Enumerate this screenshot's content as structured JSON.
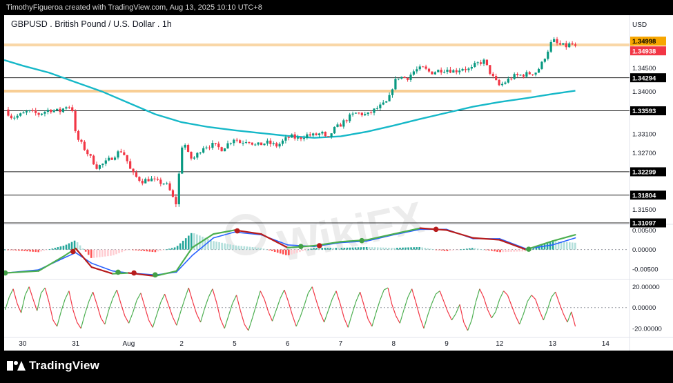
{
  "header": {
    "caption": "TimothyFigueroa created with TradingView.com, Aug 13, 2025 10:10 UTC+8"
  },
  "footer": {
    "brand": "TradingView"
  },
  "watermark": {
    "text": "WikiFX"
  },
  "chart_data": {
    "type": "candlestick",
    "title": "GBPUSD . British Pound / U.S. Dollar . 1h",
    "currency": "USD",
    "price_axis": {
      "range": [
        1.312,
        1.3527
      ],
      "ticks": [
        {
          "value": 1.345,
          "label": "1.34500"
        },
        {
          "value": 1.34,
          "label": "1.34000"
        },
        {
          "value": 1.331,
          "label": "1.33100"
        },
        {
          "value": 1.327,
          "label": "1.32700"
        },
        {
          "value": 1.315,
          "label": "1.31500"
        }
      ],
      "price_labels": [
        {
          "value": 1.34998,
          "label": "1.34998",
          "bg": "#f7a600",
          "fg": "#000000"
        },
        {
          "value": 1.34938,
          "label": "1.34938",
          "bg": "#f23645",
          "fg": "#ffffff"
        },
        {
          "value": 1.34294,
          "label": "1.34294",
          "bg": "#000000",
          "fg": "#ffffff"
        },
        {
          "value": 1.33593,
          "label": "1.33593",
          "bg": "#000000",
          "fg": "#ffffff"
        },
        {
          "value": 1.32299,
          "label": "1.32299",
          "bg": "#000000",
          "fg": "#ffffff"
        },
        {
          "value": 1.31804,
          "label": "1.31804",
          "bg": "#000000",
          "fg": "#ffffff"
        },
        {
          "value": 1.31097,
          "label": "1.31097",
          "bg": "#000000",
          "fg": "#ffffff"
        }
      ]
    },
    "horizontal_lines": [
      1.34294,
      1.33593,
      1.32299,
      1.31804,
      1.31097
    ],
    "resistance_band": [
      1.3496,
      1.3502
    ],
    "support_band": [
      1.3398,
      1.3404
    ],
    "time_axis": {
      "labels": [
        {
          "t": 0.0,
          "label": "30"
        },
        {
          "t": 1.0,
          "label": "31"
        },
        {
          "t": 2.0,
          "label": "Aug"
        },
        {
          "t": 3.0,
          "label": "2"
        },
        {
          "t": 4.0,
          "label": "5"
        },
        {
          "t": 5.0,
          "label": "6"
        },
        {
          "t": 6.0,
          "label": "7"
        },
        {
          "t": 7.0,
          "label": "8"
        },
        {
          "t": 8.0,
          "label": "9"
        },
        {
          "t": 9.0,
          "label": "12"
        },
        {
          "t": 10.0,
          "label": "13"
        },
        {
          "t": 11.0,
          "label": "14"
        }
      ],
      "range": [
        -0.35,
        11.4
      ]
    },
    "price_path": [
      [
        -0.33,
        1.3362
      ],
      [
        -0.2,
        1.3345
      ],
      [
        -0.05,
        1.335
      ],
      [
        0.1,
        1.3358
      ],
      [
        0.3,
        1.3352
      ],
      [
        0.5,
        1.3362
      ],
      [
        0.7,
        1.3358
      ],
      [
        0.85,
        1.3372
      ],
      [
        0.95,
        1.336
      ],
      [
        1.0,
        1.3305
      ],
      [
        1.1,
        1.329
      ],
      [
        1.25,
        1.3265
      ],
      [
        1.4,
        1.324
      ],
      [
        1.55,
        1.3248
      ],
      [
        1.7,
        1.3262
      ],
      [
        1.85,
        1.3275
      ],
      [
        1.95,
        1.3262
      ],
      [
        2.0,
        1.324
      ],
      [
        2.1,
        1.3222
      ],
      [
        2.25,
        1.321
      ],
      [
        2.4,
        1.3215
      ],
      [
        2.55,
        1.3208
      ],
      [
        2.7,
        1.3205
      ],
      [
        2.8,
        1.3185
      ],
      [
        2.88,
        1.316
      ],
      [
        2.92,
        1.317
      ],
      [
        2.98,
        1.328
      ],
      [
        3.05,
        1.3292
      ],
      [
        3.15,
        1.3258
      ],
      [
        3.25,
        1.326
      ],
      [
        3.4,
        1.3283
      ],
      [
        3.6,
        1.3287
      ],
      [
        3.75,
        1.3278
      ],
      [
        3.9,
        1.3292
      ],
      [
        4.0,
        1.3302
      ],
      [
        4.1,
        1.3292
      ],
      [
        4.25,
        1.3298
      ],
      [
        4.4,
        1.3285
      ],
      [
        4.6,
        1.3292
      ],
      [
        4.8,
        1.3285
      ],
      [
        4.95,
        1.3298
      ],
      [
        5.05,
        1.3305
      ],
      [
        5.2,
        1.33
      ],
      [
        5.35,
        1.3308
      ],
      [
        5.5,
        1.3307
      ],
      [
        5.65,
        1.3312
      ],
      [
        5.75,
        1.3295
      ],
      [
        5.85,
        1.3318
      ],
      [
        6.0,
        1.333
      ],
      [
        6.15,
        1.3345
      ],
      [
        6.3,
        1.3355
      ],
      [
        6.5,
        1.335
      ],
      [
        6.65,
        1.3362
      ],
      [
        6.8,
        1.3372
      ],
      [
        6.9,
        1.338
      ],
      [
        7.0,
        1.3418
      ],
      [
        7.1,
        1.3432
      ],
      [
        7.25,
        1.3428
      ],
      [
        7.4,
        1.3445
      ],
      [
        7.55,
        1.345
      ],
      [
        7.7,
        1.344
      ],
      [
        7.85,
        1.3445
      ],
      [
        8.0,
        1.3448
      ],
      [
        8.15,
        1.3443
      ],
      [
        8.3,
        1.345
      ],
      [
        8.45,
        1.3446
      ],
      [
        8.55,
        1.3458
      ],
      [
        8.7,
        1.3465
      ],
      [
        8.8,
        1.3445
      ],
      [
        8.9,
        1.3425
      ],
      [
        9.0,
        1.3412
      ],
      [
        9.1,
        1.342
      ],
      [
        9.25,
        1.3432
      ],
      [
        9.4,
        1.3435
      ],
      [
        9.55,
        1.3438
      ],
      [
        9.7,
        1.3442
      ],
      [
        9.8,
        1.346
      ],
      [
        9.9,
        1.3485
      ],
      [
        10.0,
        1.351
      ],
      [
        10.1,
        1.35
      ],
      [
        10.25,
        1.3496
      ],
      [
        10.35,
        1.3502
      ],
      [
        10.43,
        1.3494
      ]
    ],
    "moving_average": [
      [
        -0.35,
        1.3467
      ],
      [
        0.0,
        1.3455
      ],
      [
        0.5,
        1.344
      ],
      [
        1.0,
        1.342
      ],
      [
        1.5,
        1.34
      ],
      [
        2.0,
        1.3376
      ],
      [
        2.5,
        1.3352
      ],
      [
        3.0,
        1.3335
      ],
      [
        3.5,
        1.3325
      ],
      [
        4.0,
        1.3318
      ],
      [
        4.5,
        1.3312
      ],
      [
        5.0,
        1.3306
      ],
      [
        5.5,
        1.3302
      ],
      [
        6.0,
        1.3305
      ],
      [
        6.5,
        1.3315
      ],
      [
        7.0,
        1.3328
      ],
      [
        7.5,
        1.3342
      ],
      [
        8.0,
        1.3355
      ],
      [
        8.5,
        1.3368
      ],
      [
        9.0,
        1.3378
      ],
      [
        9.5,
        1.3386
      ],
      [
        10.0,
        1.3395
      ],
      [
        10.43,
        1.3402
      ]
    ],
    "macd": {
      "axis": [
        {
          "value": 0.005,
          "label": "0.00500"
        },
        {
          "value": 0.0,
          "label": "0.00000"
        },
        {
          "value": -0.005,
          "label": "-0.00500"
        }
      ],
      "range": [
        -0.0075,
        0.0065
      ],
      "macd_line": [
        [
          -0.33,
          -0.006
        ],
        [
          0.3,
          -0.0055
        ],
        [
          0.8,
          -0.0015
        ],
        [
          1.0,
          0.0003
        ],
        [
          1.3,
          -0.0045
        ],
        [
          1.7,
          -0.0062
        ],
        [
          2.0,
          -0.006
        ],
        [
          2.5,
          -0.0068
        ],
        [
          2.9,
          -0.0055
        ],
        [
          3.2,
          0.0005
        ],
        [
          3.6,
          0.004
        ],
        [
          4.0,
          0.005
        ],
        [
          4.5,
          0.004
        ],
        [
          5.0,
          0.0005
        ],
        [
          5.5,
          0.001
        ],
        [
          6.0,
          0.002
        ],
        [
          6.5,
          0.0025
        ],
        [
          7.0,
          0.004
        ],
        [
          7.5,
          0.0055
        ],
        [
          8.0,
          0.005
        ],
        [
          8.5,
          0.003
        ],
        [
          9.0,
          0.0025
        ],
        [
          9.5,
          0.0
        ],
        [
          10.0,
          0.0022
        ],
        [
          10.43,
          0.0038
        ]
      ],
      "signal_line": [
        [
          -0.33,
          -0.006
        ],
        [
          0.3,
          -0.0052
        ],
        [
          0.8,
          -0.002
        ],
        [
          1.0,
          -0.0008
        ],
        [
          1.3,
          -0.0035
        ],
        [
          1.7,
          -0.0055
        ],
        [
          2.0,
          -0.006
        ],
        [
          2.5,
          -0.0065
        ],
        [
          2.9,
          -0.0058
        ],
        [
          3.2,
          -0.0015
        ],
        [
          3.6,
          0.003
        ],
        [
          4.0,
          0.0045
        ],
        [
          4.5,
          0.0038
        ],
        [
          5.0,
          0.0012
        ],
        [
          5.5,
          0.0008
        ],
        [
          6.0,
          0.0018
        ],
        [
          6.5,
          0.0022
        ],
        [
          7.0,
          0.0038
        ],
        [
          7.5,
          0.0052
        ],
        [
          8.0,
          0.0052
        ],
        [
          8.5,
          0.0028
        ],
        [
          9.0,
          0.0028
        ],
        [
          9.5,
          0.0002
        ],
        [
          10.0,
          0.0012
        ],
        [
          10.43,
          0.003
        ]
      ],
      "crosses": [
        {
          "t": -0.33,
          "v": -0.006,
          "kind": "bull"
        },
        {
          "t": 0.95,
          "v": -0.0005,
          "kind": "bear"
        },
        {
          "t": 1.8,
          "v": -0.0058,
          "kind": "bull"
        },
        {
          "t": 2.1,
          "v": -0.006,
          "kind": "bear"
        },
        {
          "t": 2.5,
          "v": -0.0065,
          "kind": "bull"
        },
        {
          "t": 4.05,
          "v": 0.0048,
          "kind": "bear"
        },
        {
          "t": 5.25,
          "v": 0.0008,
          "kind": "bull"
        },
        {
          "t": 5.6,
          "v": 0.001,
          "kind": "bear"
        },
        {
          "t": 6.4,
          "v": 0.0023,
          "kind": "bull"
        },
        {
          "t": 7.8,
          "v": 0.0052,
          "kind": "bear"
        },
        {
          "t": 9.55,
          "v": 0.0001,
          "kind": "bull"
        }
      ]
    },
    "oscillator": {
      "axis": [
        {
          "value": 20,
          "label": "20.00000"
        },
        {
          "value": 0,
          "label": "0.00000"
        },
        {
          "value": -20,
          "label": "-20.00000"
        }
      ],
      "range": [
        -28,
        27
      ],
      "values": [
        -2,
        10,
        18,
        4,
        -5,
        12,
        20,
        8,
        -3,
        14,
        19,
        5,
        -12,
        -18,
        -4,
        8,
        16,
        -2,
        -14,
        -20,
        -6,
        6,
        15,
        3,
        -10,
        -16,
        -2,
        9,
        17,
        4,
        -8,
        -15,
        -5,
        7,
        14,
        1,
        -12,
        -19,
        -7,
        5,
        13,
        2,
        -9,
        -17,
        -4,
        8,
        19,
        6,
        -6,
        -14,
        -1,
        10,
        18,
        5,
        -11,
        -20,
        -8,
        4,
        12,
        -3,
        -16,
        -22,
        -10,
        3,
        16,
        8,
        -4,
        -13,
        -2,
        9,
        17,
        6,
        -7,
        -18,
        -9,
        2,
        14,
        20,
        7,
        -5,
        -14,
        -3,
        8,
        16,
        4,
        -10,
        -19,
        -6,
        6,
        15,
        2,
        -11,
        -18,
        -5,
        7,
        17,
        19,
        3,
        -8,
        -15,
        -2,
        10,
        18,
        5,
        -9,
        -20,
        -7,
        4,
        13,
        16,
        6,
        -4,
        -12,
        -6,
        3,
        -14,
        -22,
        -12,
        5,
        18,
        10,
        -2,
        -10,
        -4,
        8,
        16,
        12,
        2,
        -8,
        -16,
        -6,
        6,
        12,
        8,
        -3,
        -12,
        -2,
        10,
        15,
        4,
        -6,
        -14,
        -4,
        -18
      ]
    }
  }
}
